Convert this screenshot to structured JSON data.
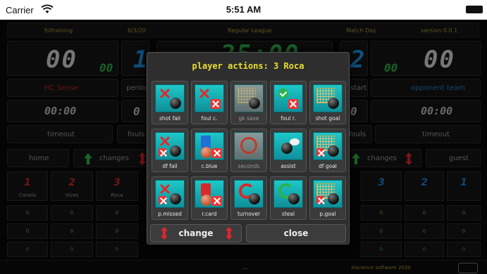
{
  "status": {
    "carrier": "Carrier",
    "time": "5:51 AM"
  },
  "scoreboard": {
    "info": [
      "fsltraining",
      "6/3/20",
      "Regular League",
      "Match Day",
      "version 0.0.1"
    ],
    "home_score": "00",
    "guest_score": "00",
    "home_fouls_small": "00",
    "guest_fouls_small": "00",
    "home_period": "1",
    "guest_period": "2",
    "game_clock": "25:00",
    "home_team": "HC Sense",
    "guest_team": "opponent team",
    "period_label": "period",
    "start_label": "start",
    "home_timer": "00:00",
    "guest_timer": "00:00",
    "home_timer_count": "0",
    "guest_timer_count": "0",
    "timeout": "timeout",
    "fouls": "fouls",
    "home": "home",
    "guest": "guest",
    "changes": "changes",
    "copyright": "xlscience software 2020",
    "dots": "...",
    "players_left": [
      {
        "num": "1",
        "name": "Canela"
      },
      {
        "num": "2",
        "name": "Vives"
      },
      {
        "num": "3",
        "name": "Roca"
      }
    ],
    "players_right": [
      {
        "num": "3"
      },
      {
        "num": "2"
      },
      {
        "num": "1"
      }
    ]
  },
  "popup": {
    "title": "player actions: 3 Roca",
    "actions": [
      {
        "label": "shot fail",
        "icon": "shot-fail-icon"
      },
      {
        "label": "foul c.",
        "icon": "foul-committed-icon"
      },
      {
        "label": "gk save",
        "icon": "goalkeeper-save-icon"
      },
      {
        "label": "foul r.",
        "icon": "foul-received-icon"
      },
      {
        "label": "shot goal",
        "icon": "shot-goal-icon"
      },
      {
        "label": "df fail",
        "icon": "defense-fail-icon"
      },
      {
        "label": "c.blue",
        "icon": "blue-card-icon"
      },
      {
        "label": "seconds",
        "icon": "seconds-icon"
      },
      {
        "label": "assist",
        "icon": "assist-icon"
      },
      {
        "label": "df goal",
        "icon": "defense-goal-icon"
      },
      {
        "label": "p.missed",
        "icon": "penalty-missed-icon"
      },
      {
        "label": "r.card",
        "icon": "red-card-icon"
      },
      {
        "label": "turnover",
        "icon": "turnover-icon"
      },
      {
        "label": "steal",
        "icon": "steal-icon"
      },
      {
        "label": "p.goal",
        "icon": "penalty-goal-icon"
      }
    ],
    "change_label": "change",
    "close_label": "close"
  }
}
